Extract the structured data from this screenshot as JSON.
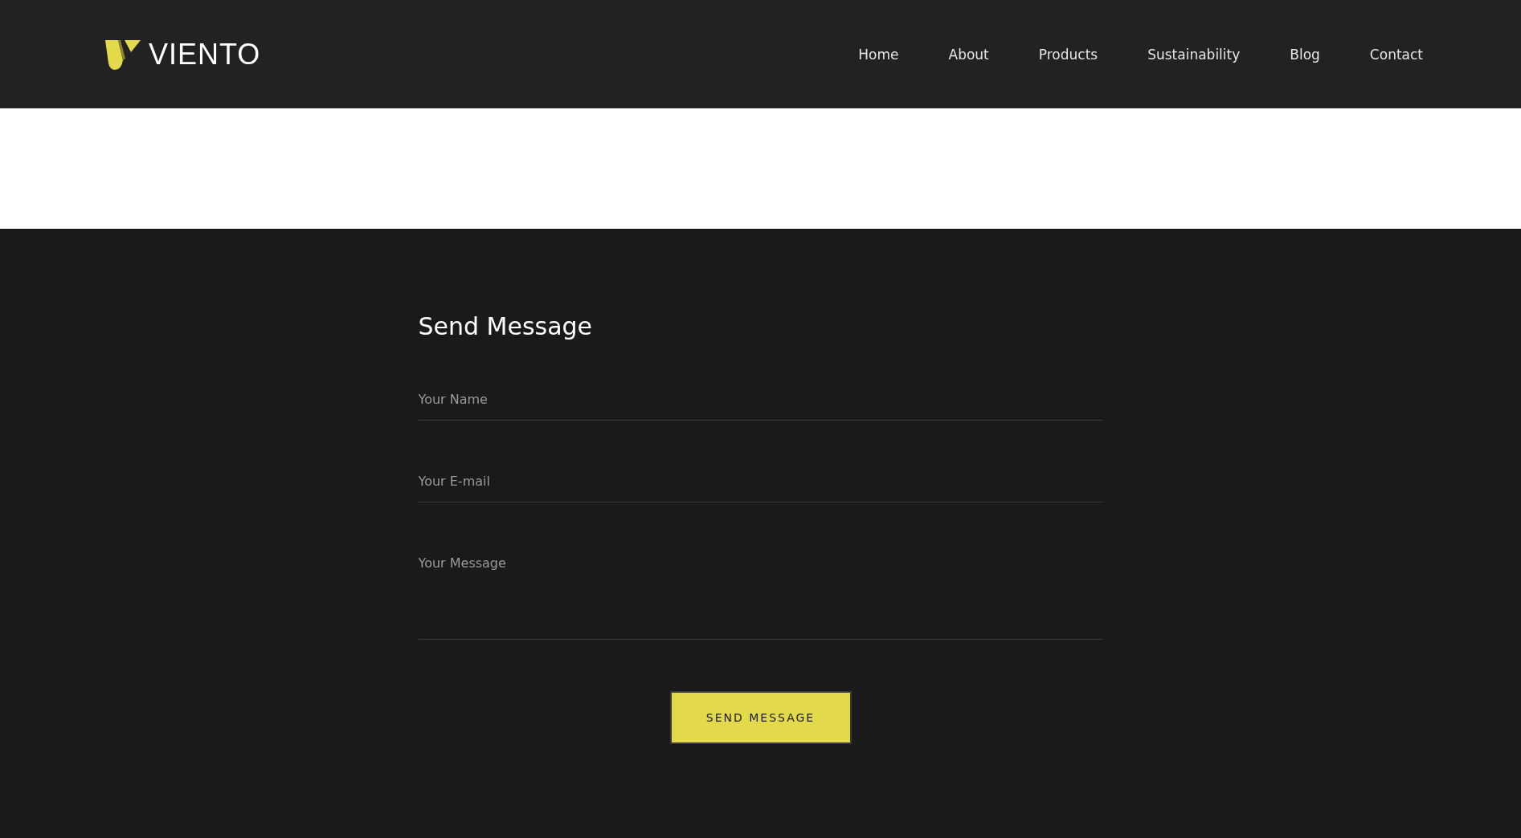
{
  "logo": {
    "text": "VIENTO"
  },
  "nav": [
    {
      "label": "Home"
    },
    {
      "label": "About"
    },
    {
      "label": "Products"
    },
    {
      "label": "Sustainability"
    },
    {
      "label": "Blog"
    },
    {
      "label": "Contact"
    }
  ],
  "form": {
    "title": "Send Message",
    "fields": [
      {
        "kind": "input",
        "placeholder": "Your Name"
      },
      {
        "kind": "input",
        "placeholder": "Your E-mail"
      },
      {
        "kind": "textarea",
        "placeholder": "Your Message"
      }
    ],
    "button": "SEND MESSAGE"
  }
}
